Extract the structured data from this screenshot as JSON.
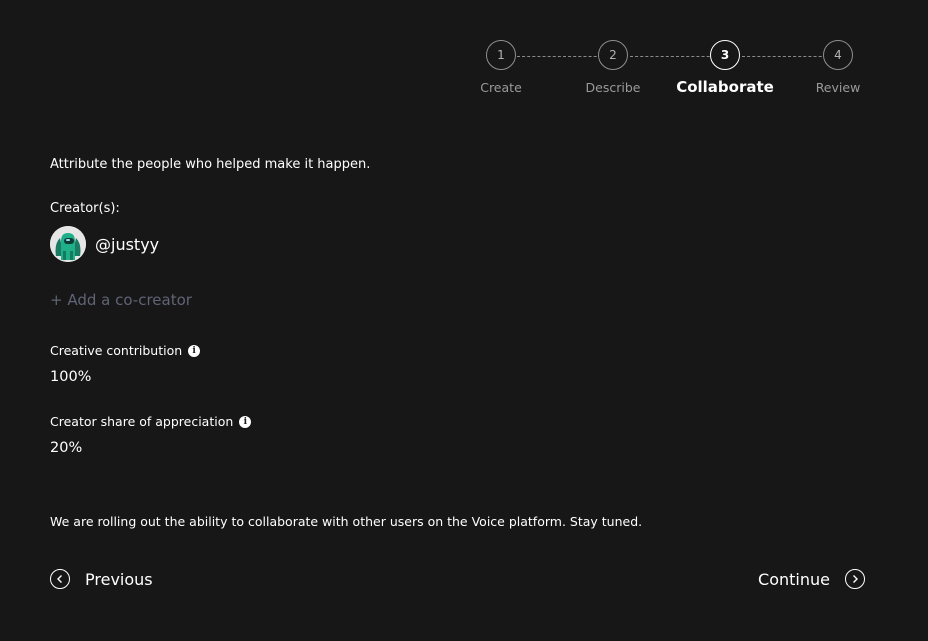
{
  "stepper": {
    "steps": [
      {
        "number": "1",
        "label": "Create"
      },
      {
        "number": "2",
        "label": "Describe"
      },
      {
        "number": "3",
        "label": "Collaborate"
      },
      {
        "number": "4",
        "label": "Review"
      }
    ],
    "active_step": 3
  },
  "intro_text": "Attribute the people who helped make it happen.",
  "creators": {
    "label": "Creator(s):",
    "items": [
      {
        "handle": "@justyy",
        "avatar_icon": "amongus-avatar-icon"
      }
    ]
  },
  "add_cocreator_label": "+ Add a co-creator",
  "creative_contribution": {
    "label": "Creative contribution",
    "value": "100%"
  },
  "creator_share": {
    "label": "Creator share of appreciation",
    "value": "20%"
  },
  "notice_text": "We are rolling out the ability to collaborate with other users on the Voice platform. Stay tuned.",
  "navigation": {
    "previous_label": "Previous",
    "continue_label": "Continue"
  },
  "colors": {
    "background": "#171717",
    "text": "#ffffff",
    "muted": "#5f6476",
    "avatar_accent": "#1fb08a"
  }
}
